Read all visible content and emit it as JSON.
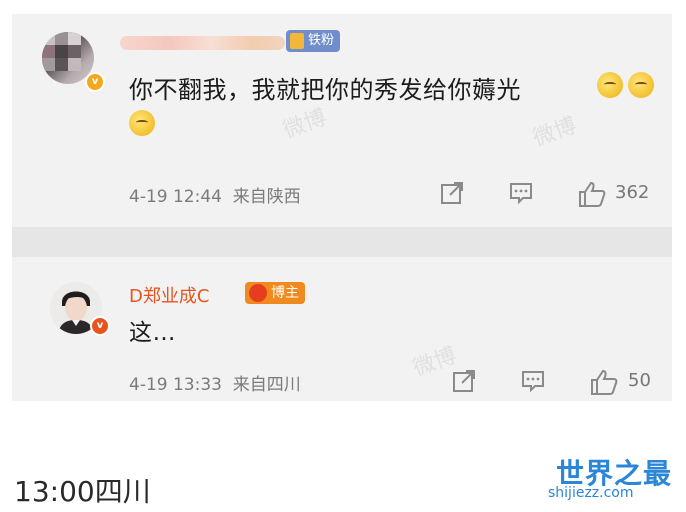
{
  "comments": [
    {
      "text": "你不翻我，我就把你的秀发给你薅光",
      "badge": "铁粉",
      "verified_mark": "v",
      "emoji": [
        "thinking-face-icon",
        "thinking-face-icon",
        "thinking-face-icon"
      ],
      "time": "4-19 12:44",
      "location": "来自陕西",
      "likes": "362"
    },
    {
      "author": "D郑业成C",
      "badge": "博主",
      "verified_mark": "v",
      "text": "这…",
      "time": "4-19 13:33",
      "location": "来自四川",
      "likes": "50"
    }
  ],
  "actions": [
    "share-icon",
    "comment-icon",
    "like-icon"
  ],
  "bottom_caption": "13:00四川",
  "logo": {
    "main": "世界之最",
    "sub": "shijiezz.com"
  },
  "colors": {
    "author_name": "#e8541e",
    "fan_badge": "#6f8ecb",
    "blogger_badge": "#f08a1f",
    "logo": "#2b86d8"
  }
}
